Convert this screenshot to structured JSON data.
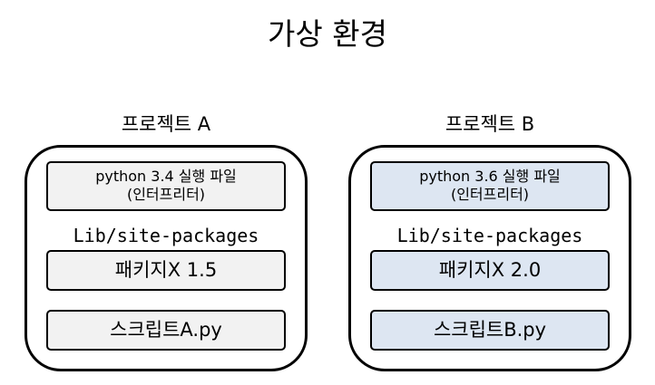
{
  "title": "가상 환경",
  "projects": [
    {
      "label": "프로젝트 A",
      "interpreter_line1": "python 3.4 실행 파일",
      "interpreter_line2": "(인터프리터)",
      "lib_label": "Lib/site-packages",
      "package": "패키지X 1.5",
      "script": "스크립트A.py",
      "fill_color": "#f2f2f2"
    },
    {
      "label": "프로젝트 B",
      "interpreter_line1": "python 3.6 실행 파일",
      "interpreter_line2": "(인터프리터)",
      "lib_label": "Lib/site-packages",
      "package": "패키지X 2.0",
      "script": "스크립트B.py",
      "fill_color": "#dde6f2"
    }
  ]
}
